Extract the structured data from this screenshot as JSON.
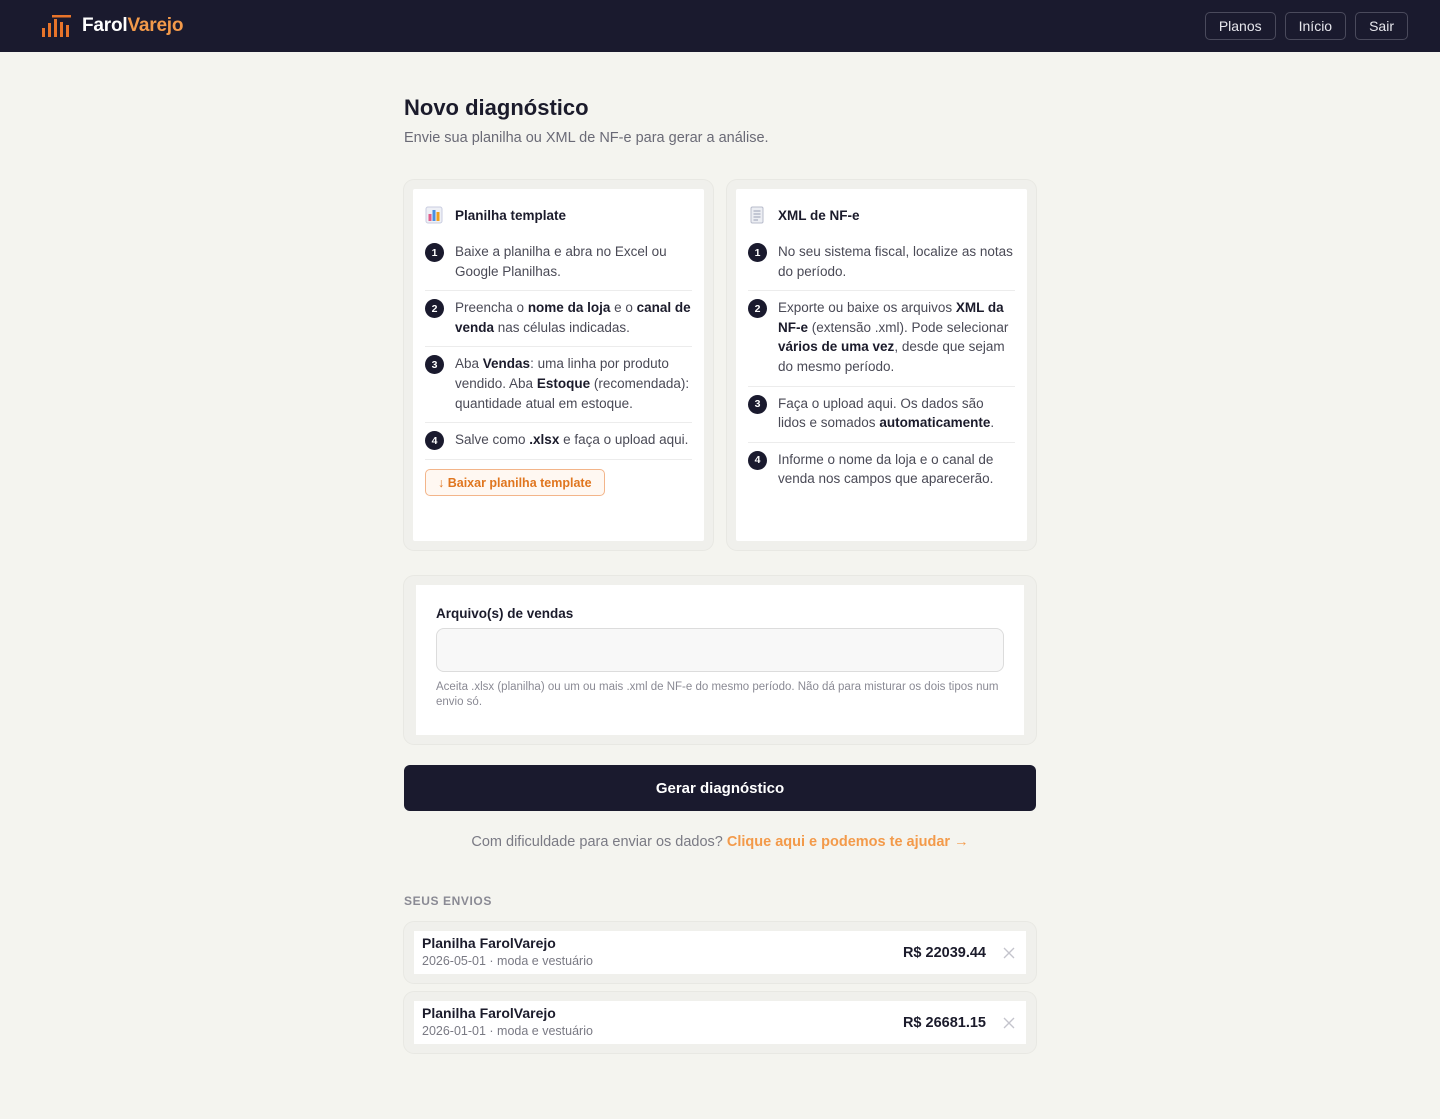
{
  "brand": {
    "name_part1": "Farol",
    "name_part2": "Varejo",
    "accent": "#f39a4a",
    "logo_icon": "bar-chart-icon"
  },
  "nav": {
    "plans": "Planos",
    "home": "Início",
    "logout": "Sair"
  },
  "page": {
    "title": "Novo diagnóstico",
    "subtitle": "Envie sua planilha ou XML de NF-e para gerar a análise."
  },
  "template_card": {
    "icon": "spreadsheet-chart-icon",
    "title": "Planilha template",
    "steps": [
      {
        "num": "1",
        "html": "Baixe a planilha e abra no Excel ou Google Planilhas."
      },
      {
        "num": "2",
        "html": "Preencha o <b>nome da loja</b> e o <b>canal de venda</b> nas células indicadas."
      },
      {
        "num": "3",
        "html": "Aba <b>Vendas</b>: uma linha por produto vendido. Aba <b>Estoque</b> (recomendada): quantidade atual em estoque."
      },
      {
        "num": "4",
        "html": "Salve como <b>.xlsx</b> e faça o upload aqui."
      }
    ],
    "download_label": "↓ Baixar planilha template"
  },
  "xml_card": {
    "icon": "document-icon",
    "title": "XML de NF-e",
    "steps": [
      {
        "num": "1",
        "html": "No seu sistema fiscal, localize as notas do período."
      },
      {
        "num": "2",
        "html": "Exporte ou baixe os arquivos <b>XML da NF-e</b> (extensão .xml). Pode selecionar <b>vários de uma vez</b>, desde que sejam do mesmo período."
      },
      {
        "num": "3",
        "html": "Faça o upload aqui. Os dados são lidos e somados <b>automaticamente</b>."
      },
      {
        "num": "4",
        "html": "Informe o nome da loja e o canal de venda nos campos que aparecerão."
      }
    ]
  },
  "upload": {
    "label": "Arquivo(s) de vendas",
    "value": "",
    "help": "Aceita .xlsx (planilha) ou um ou mais .xml de NF-e do mesmo período. Não dá para misturar os dois tipos num envio só."
  },
  "generate_button": "Gerar diagnóstico",
  "help": {
    "text": "Com dificuldade para enviar os dados?",
    "link": "Clique aqui e podemos te ajudar →"
  },
  "submissions": {
    "heading": "SEUS ENVIOS",
    "items": [
      {
        "name": "Planilha FarolVarejo",
        "meta": "2026-05-01 · moda e vestuário",
        "amount": "R$ 22039.44"
      },
      {
        "name": "Planilha FarolVarejo",
        "meta": "2026-01-01 · moda e vestuário",
        "amount": "R$ 26681.15"
      }
    ]
  }
}
